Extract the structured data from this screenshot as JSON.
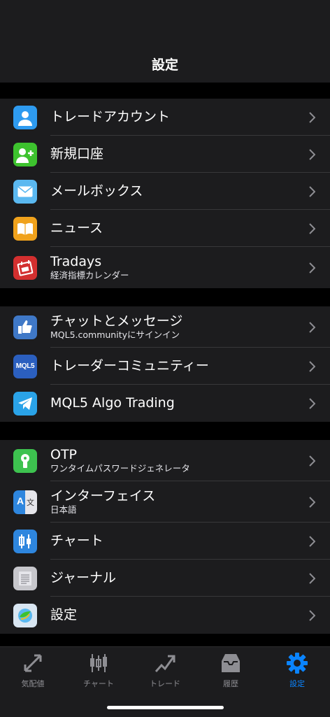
{
  "header": {
    "title": "設定"
  },
  "sections": [
    {
      "items": [
        {
          "label": "トレードアカウント",
          "icon": "user-icon",
          "color": "#2e9bf0"
        },
        {
          "label": "新規口座",
          "icon": "add-user-icon",
          "color": "#3dc22e"
        },
        {
          "label": "メールボックス",
          "icon": "mail-icon",
          "color": "#5ab8f0"
        },
        {
          "label": "ニュース",
          "icon": "book-icon",
          "color": "#f0a21c"
        },
        {
          "label": "Tradays",
          "sub": "経済指標カレンダー",
          "icon": "calendar-icon",
          "color": "#d32f2f"
        }
      ]
    },
    {
      "items": [
        {
          "label": "チャットとメッセージ",
          "sub": "MQL5.communityにサインイン",
          "icon": "thumbs-up-icon",
          "color": "#3f78c7"
        },
        {
          "label": "トレーダーコミュニティー",
          "icon": "mql5-logo-icon",
          "color": "#2b5fbf",
          "badge": "MQL5"
        },
        {
          "label": "MQL5 Algo Trading",
          "icon": "telegram-icon",
          "color": "#2aa3e8"
        }
      ]
    },
    {
      "items": [
        {
          "label": "OTP",
          "sub": "ワンタイムパスワードジェネレータ",
          "icon": "keyhole-icon",
          "color": "#3dc24f"
        },
        {
          "label": "インターフェイス",
          "sub": "日本語",
          "icon": "translate-icon",
          "color": "#2e86de",
          "badge_left": "A",
          "badge_right": "文"
        },
        {
          "label": "チャート",
          "icon": "candles-icon",
          "color": "#2e86de"
        },
        {
          "label": "ジャーナル",
          "icon": "journal-icon",
          "color": "#c7c7cc"
        },
        {
          "label": "設定",
          "icon": "metatrader-icon",
          "color": "#d9e6f2"
        }
      ]
    }
  ],
  "tabbar": {
    "tabs": [
      {
        "label": "気配値",
        "icon": "quotes-icon"
      },
      {
        "label": "チャート",
        "icon": "chart-icon"
      },
      {
        "label": "トレード",
        "icon": "trade-icon"
      },
      {
        "label": "履歴",
        "icon": "history-icon"
      },
      {
        "label": "設定",
        "icon": "settings-icon",
        "active": true
      }
    ],
    "active_color": "#0a84ff",
    "inactive_color": "#8e8e93"
  }
}
